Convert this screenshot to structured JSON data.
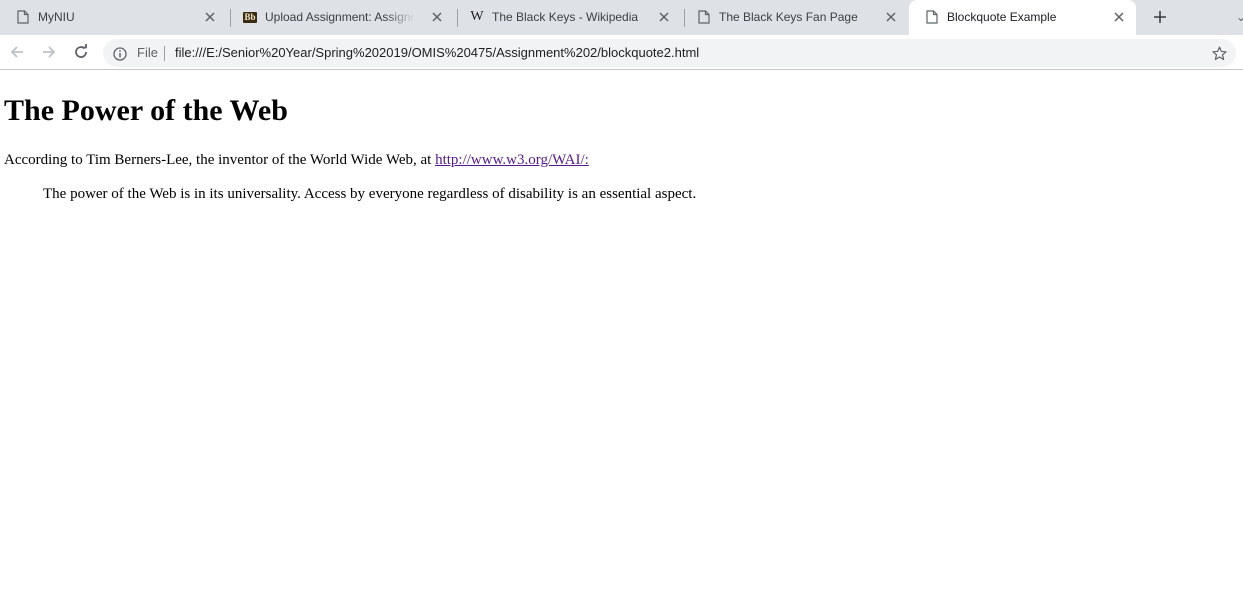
{
  "browser": {
    "tabs": [
      {
        "title": "MyNIU",
        "favicon": "page-icon",
        "active": false
      },
      {
        "title": "Upload Assignment: Assignment",
        "favicon": "blackboard-icon",
        "favicon_text": "Bb",
        "active": false
      },
      {
        "title": "The Black Keys - Wikipedia",
        "favicon": "wikipedia-icon",
        "favicon_text": "W",
        "active": false
      },
      {
        "title": "The Black Keys Fan Page",
        "favicon": "page-icon",
        "active": false
      },
      {
        "title": "Blockquote Example",
        "favicon": "page-icon",
        "active": true
      }
    ],
    "new_tab_icon": "plus-icon",
    "toolbar": {
      "back_icon": "back-arrow-icon",
      "forward_icon": "forward-arrow-icon",
      "reload_icon": "reload-icon",
      "site_info_icon": "info-icon",
      "scheme_label": "File",
      "url": "file:///E:/Senior%20Year/Spring%202019/OMIS%20475/Assignment%202/blockquote2.html",
      "bookmark_icon": "star-icon"
    }
  },
  "page": {
    "heading": "The Power of the Web",
    "intro_text": "According to Tim Berners-Lee, the inventor of the World Wide Web, at ",
    "link_text": "http://www.w3.org/WAI/:",
    "quote": "The power of the Web is in its universality. Access by everyone regardless of disability is an essential aspect."
  },
  "colors": {
    "tabstrip_bg": "#dee1e6",
    "omnibox_bg": "#f1f3f4",
    "visited_link": "#551a8b"
  }
}
